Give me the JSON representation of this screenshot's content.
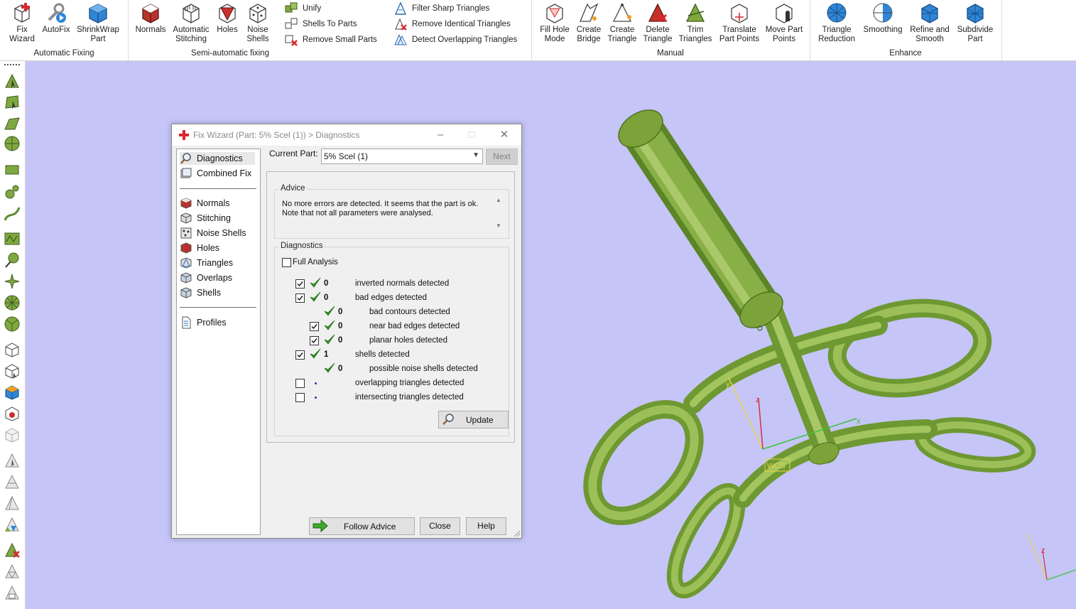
{
  "ribbon": {
    "groups": [
      {
        "title": "Automatic Fixing",
        "buttons": [
          "Fix\nWizard",
          "AutoFix",
          "ShrinkWrap\nPart"
        ]
      },
      {
        "title": "Semi-automatic fixing",
        "buttons": [
          "Normals",
          "Automatic\nStitching",
          "Holes",
          "Noise\nShells"
        ],
        "small": [
          "Unify",
          "Shells To Parts",
          "Remove Small Parts",
          "Filter Sharp Triangles",
          "Remove Identical Triangles",
          "Detect Overlapping Triangles"
        ]
      },
      {
        "title": "Manual",
        "buttons": [
          "Fill Hole\nMode",
          "Create\nBridge",
          "Create\nTriangle",
          "Delete\nTriangle",
          "Trim\nTriangles",
          "Translate\nPart Points",
          "Move Part\nPoints"
        ]
      },
      {
        "title": "Enhance",
        "buttons": [
          "Triangle\nReduction",
          "Smoothing",
          "Refine and\nSmooth",
          "Subdivide\nPart"
        ]
      }
    ]
  },
  "dialog": {
    "title": "Fix Wizard (Part: 5% Scel (1)) > Diagnostics",
    "nav": [
      "Diagnostics",
      "Combined Fix",
      "Normals",
      "Stitching",
      "Noise Shells",
      "Holes",
      "Triangles",
      "Overlaps",
      "Shells",
      "Profiles"
    ],
    "current_part_label": "Current Part:",
    "current_part_value": "5% Scel (1)",
    "next_label": "Next",
    "advice_title": "Advice",
    "advice_text": "No more errors are detected. It seems that the part is ok. Note that not all parameters were analysed.",
    "diagnostics_title": "Diagnostics",
    "full_analysis_label": "Full Analysis",
    "full_analysis_checked": false,
    "rows": [
      {
        "count": "0",
        "label": "inverted normals detected",
        "checked": true,
        "status": "ok",
        "indent": 0,
        "has_checkbox": true
      },
      {
        "count": "0",
        "label": "bad edges detected",
        "checked": true,
        "status": "ok",
        "indent": 0,
        "has_checkbox": true
      },
      {
        "count": "0",
        "label": "bad contours detected",
        "checked": false,
        "status": "ok",
        "indent": 1,
        "has_checkbox": false
      },
      {
        "count": "0",
        "label": "near bad edges detected",
        "checked": true,
        "status": "ok",
        "indent": 1,
        "has_checkbox": true
      },
      {
        "count": "0",
        "label": "planar holes detected",
        "checked": true,
        "status": "ok",
        "indent": 1,
        "has_checkbox": true
      },
      {
        "count": "1",
        "label": "shells detected",
        "checked": true,
        "status": "ok",
        "indent": 0,
        "has_checkbox": true
      },
      {
        "count": "0",
        "label": "possible noise shells detected",
        "checked": false,
        "status": "ok",
        "indent": 1,
        "has_checkbox": false
      },
      {
        "count": "",
        "label": "overlapping triangles detected",
        "checked": false,
        "status": "none",
        "indent": 0,
        "has_checkbox": true
      },
      {
        "count": "",
        "label": "intersecting triangles detected",
        "checked": false,
        "status": "none",
        "indent": 0,
        "has_checkbox": true
      }
    ],
    "update_label": "Update",
    "follow_advice_label": "Follow Advice",
    "close_label": "Close",
    "help_label": "Help"
  },
  "viewport": {
    "background": "#c5c5f7",
    "model_color": "#8fb24c",
    "wcs_label": "WCS",
    "axis_labels": [
      "x",
      "y",
      "z"
    ]
  }
}
